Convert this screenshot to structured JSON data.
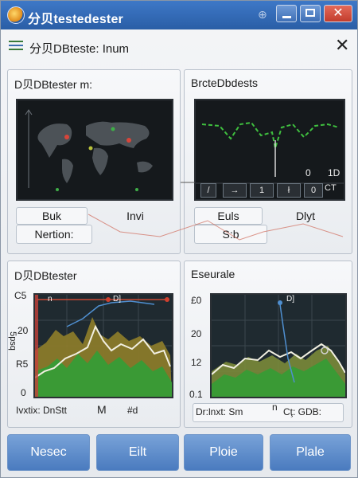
{
  "window": {
    "title": "分贝testedester"
  },
  "toolbar": {
    "title": "分贝DBteste: Inum"
  },
  "panel_map": {
    "title": "D贝DBtester m:",
    "label_a": "Buk",
    "label_b": "Invi",
    "label_c": "Nertion:"
  },
  "panel_signal": {
    "title": "BrcteDbdests",
    "readout_a": "0",
    "readout_b": "1D",
    "controls": [
      "→",
      "1",
      "ł",
      "0"
    ],
    "ct_label": "CT",
    "label_a": "Euls",
    "label_b": "Dlyt",
    "label_c": "S:b"
  },
  "panel_area_left": {
    "title": "D贝DBtester",
    "y_ticks": [
      "C5",
      "20",
      "R5",
      "0"
    ],
    "ylabel": "5psq",
    "top_marker": "D]",
    "top_left_marker": "n",
    "x_ticks": [
      "Ivxtix: DnStt",
      "M",
      "#d"
    ]
  },
  "panel_area_right": {
    "title": "Eseurale",
    "y_ticks": [
      "£0",
      "20",
      "12",
      "0.1"
    ],
    "top_marker": "D]",
    "x_ticks": [
      "Dr:lnxt: Sm",
      "n",
      "Cţ: GDB:"
    ]
  },
  "bottom_buttons": [
    "Nesec",
    "Eilt",
    "Ploie",
    "Plale"
  ],
  "colors": {
    "titlebar": "#2f66b0",
    "button": "#5a87c6",
    "area_green": "#3f9a3a",
    "area_olive": "#8a8a30",
    "line_white": "#f4f2e6",
    "marker_red": "#d0402e"
  }
}
